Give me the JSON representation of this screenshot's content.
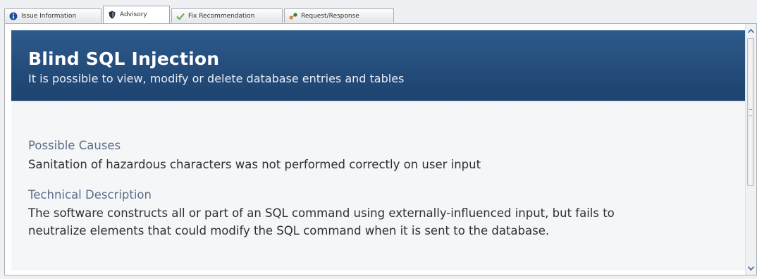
{
  "tabs": [
    {
      "label": "Issue Information",
      "icon": "info-icon"
    },
    {
      "label": "Advisory",
      "icon": "shield-icon",
      "active": true
    },
    {
      "label": "Fix Recommendation",
      "icon": "checkmark-icon"
    },
    {
      "label": "Request/Response",
      "icon": "request-response-icon"
    }
  ],
  "banner": {
    "title": "Blind SQL Injection",
    "subtitle": "It is possible to view, modify or delete database entries and tables"
  },
  "sections": {
    "causes": {
      "heading": "Possible Causes",
      "text": "Sanitation of hazardous characters was not performed correctly on user input"
    },
    "technical": {
      "heading": "Technical Description",
      "line1": "The software constructs all or part of an SQL command using externally-influenced input, but fails to",
      "line2": "neutralize elements that could modify the SQL command when it is sent to the database."
    }
  },
  "colors": {
    "banner": "#234b79",
    "section_heading": "#5c6f8a"
  }
}
